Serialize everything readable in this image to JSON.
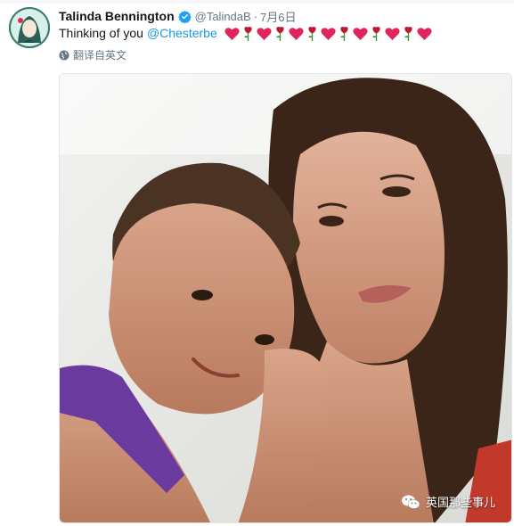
{
  "tweet": {
    "author_name": "Talinda Bennington",
    "handle": "@TalindaB",
    "separator": "·",
    "date": "7月6日",
    "text": "Thinking of you",
    "mention": "@Chesterbe",
    "emojis": [
      "heart",
      "rose",
      "heart",
      "rose",
      "heart",
      "rose",
      "heart",
      "rose",
      "heart",
      "rose",
      "heart",
      "rose",
      "heart"
    ],
    "translate_label": "翻译自英文"
  },
  "watermark": {
    "text": "英国那些事儿"
  },
  "colors": {
    "link": "#1b95e0",
    "verified": "#1da1f2",
    "heart": "#e0245e",
    "rose": "#be1931",
    "secondary_text": "#657786"
  }
}
